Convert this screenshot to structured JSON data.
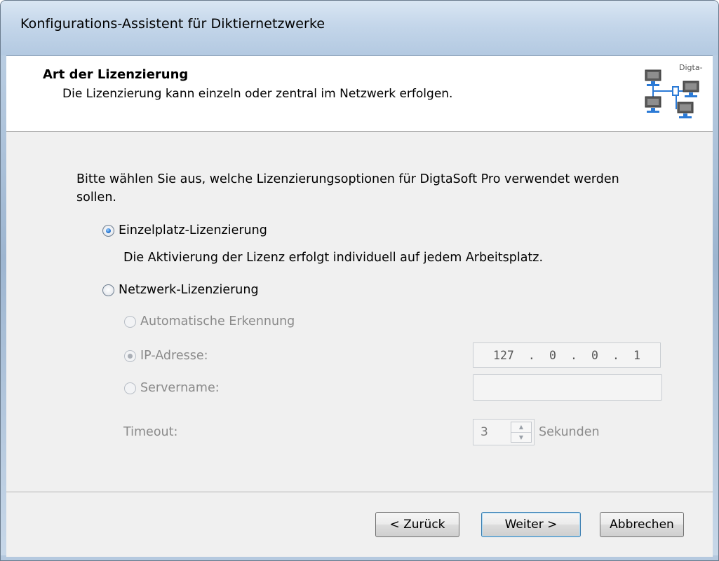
{
  "window": {
    "title": "Konfigurations-Assistent für Diktiernetzwerke"
  },
  "header": {
    "title": "Art der Lizenzierung",
    "subtitle": "Die Lizenzierung kann einzeln oder zentral im Netzwerk erfolgen.",
    "logo_text": "Digta-"
  },
  "main": {
    "intro": "Bitte wählen Sie aus, welche Lizenzierungsoptionen für DigtaSoft Pro verwendet werden sollen.",
    "option_single": {
      "label": "Einzelplatz-Lizenzierung",
      "checked": true,
      "description": "Die Aktivierung der Lizenz erfolgt individuell auf jedem Arbeitsplatz."
    },
    "option_network": {
      "label": "Netzwerk-Lizenzierung",
      "checked": false
    },
    "sub_options": {
      "auto": {
        "label": "Automatische Erkennung",
        "enabled": false
      },
      "ip": {
        "label": "IP-Adresse:",
        "checked": true,
        "enabled": false,
        "octets": [
          "127",
          "0",
          "0",
          "1"
        ]
      },
      "server": {
        "label": "Servername:",
        "enabled": false,
        "value": ""
      }
    },
    "timeout": {
      "label": "Timeout:",
      "value": "3",
      "unit": "Sekunden"
    }
  },
  "buttons": {
    "back": "< Zurück",
    "next": "Weiter >",
    "cancel": "Abbrechen"
  }
}
